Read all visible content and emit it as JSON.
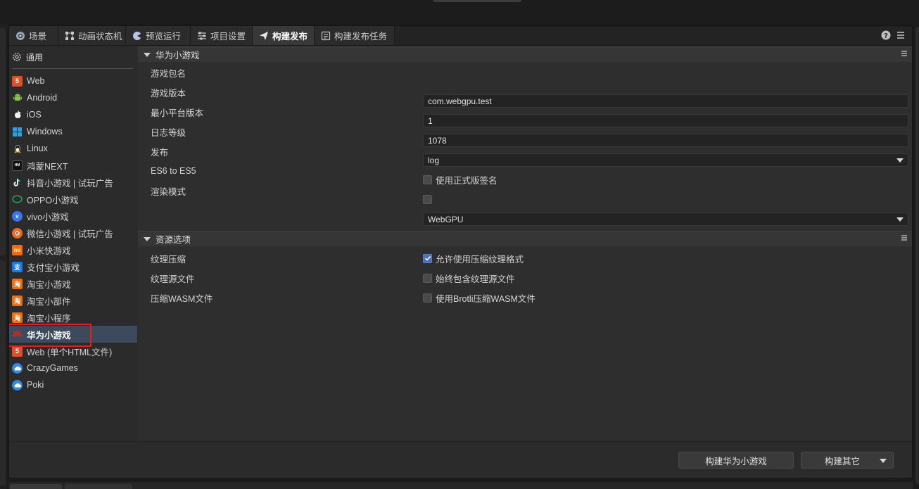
{
  "tabs": [
    {
      "label": "场景",
      "icon": "scene-icon"
    },
    {
      "label": "动画状态机",
      "icon": "state-machine-icon"
    },
    {
      "label": "预览运行",
      "icon": "preview-icon"
    },
    {
      "label": "项目设置",
      "icon": "settings-sliders-icon"
    },
    {
      "label": "构建发布",
      "icon": "send-icon",
      "active": true
    },
    {
      "label": "构建发布任务",
      "icon": "task-list-icon"
    }
  ],
  "sidebar": {
    "general_label": "通用",
    "platforms": [
      {
        "label": "Web",
        "icon": "html5-icon"
      },
      {
        "label": "Android",
        "icon": "android-icon"
      },
      {
        "label": "iOS",
        "icon": "apple-icon"
      },
      {
        "label": "Windows",
        "icon": "windows-icon"
      },
      {
        "label": "Linux",
        "icon": "linux-icon"
      },
      {
        "label": "鸿蒙NEXT",
        "icon": "harmony-icon"
      },
      {
        "label": "抖音小游戏 | 试玩广告",
        "icon": "douyin-icon"
      },
      {
        "label": "OPPO小游戏",
        "icon": "oppo-icon"
      },
      {
        "label": "vivo小游戏",
        "icon": "vivo-icon"
      },
      {
        "label": "微信小游戏 | 试玩广告",
        "icon": "wechat-icon"
      },
      {
        "label": "小米快游戏",
        "icon": "xiaomi-icon"
      },
      {
        "label": "支付宝小游戏",
        "icon": "alipay-icon"
      },
      {
        "label": "淘宝小游戏",
        "icon": "taobao-icon"
      },
      {
        "label": "淘宝小部件",
        "icon": "taobao-icon"
      },
      {
        "label": "淘宝小程序",
        "icon": "taobao-icon"
      },
      {
        "label": "华为小游戏",
        "icon": "huawei-icon",
        "selected": true
      },
      {
        "label": "Web (单个HTML文件)",
        "icon": "html5-icon"
      },
      {
        "label": "CrazyGames",
        "icon": "cloud-icon"
      },
      {
        "label": "Poki",
        "icon": "cloud-icon"
      }
    ]
  },
  "sections": {
    "huawei": {
      "title": "华为小游戏",
      "rows": {
        "package_name": {
          "label": "游戏包名",
          "value": "com.webgpu.test"
        },
        "version": {
          "label": "游戏版本",
          "value": "1"
        },
        "min_platform": {
          "label": "最小平台版本",
          "value": "1078"
        },
        "log_level": {
          "label": "日志等级",
          "value": "log"
        },
        "publish": {
          "label": "发布",
          "checkbox_label": "使用正式版签名",
          "checked": false
        },
        "es6": {
          "label": "ES6 to ES5",
          "checked": false
        },
        "render_mode": {
          "label": "渲染模式",
          "value": "WebGPU"
        }
      }
    },
    "assets": {
      "title": "资源选项",
      "rows": {
        "texture_compress": {
          "label": "纹理压缩",
          "checkbox_label": "允许使用压缩纹理格式",
          "checked": true
        },
        "texture_source": {
          "label": "纹理源文件",
          "checkbox_label": "始终包含纹理源文件",
          "checked": false
        },
        "wasm_compress": {
          "label": "压缩WASM文件",
          "checkbox_label": "使用Brotli压缩WASM文件",
          "checked": false
        }
      }
    }
  },
  "footer": {
    "build_button": "构建华为小游戏",
    "build_other_button": "构建其它"
  },
  "colors": {
    "accent": "#4a6fb5",
    "selection": "#3d4a5e",
    "highlight": "#e02020"
  }
}
